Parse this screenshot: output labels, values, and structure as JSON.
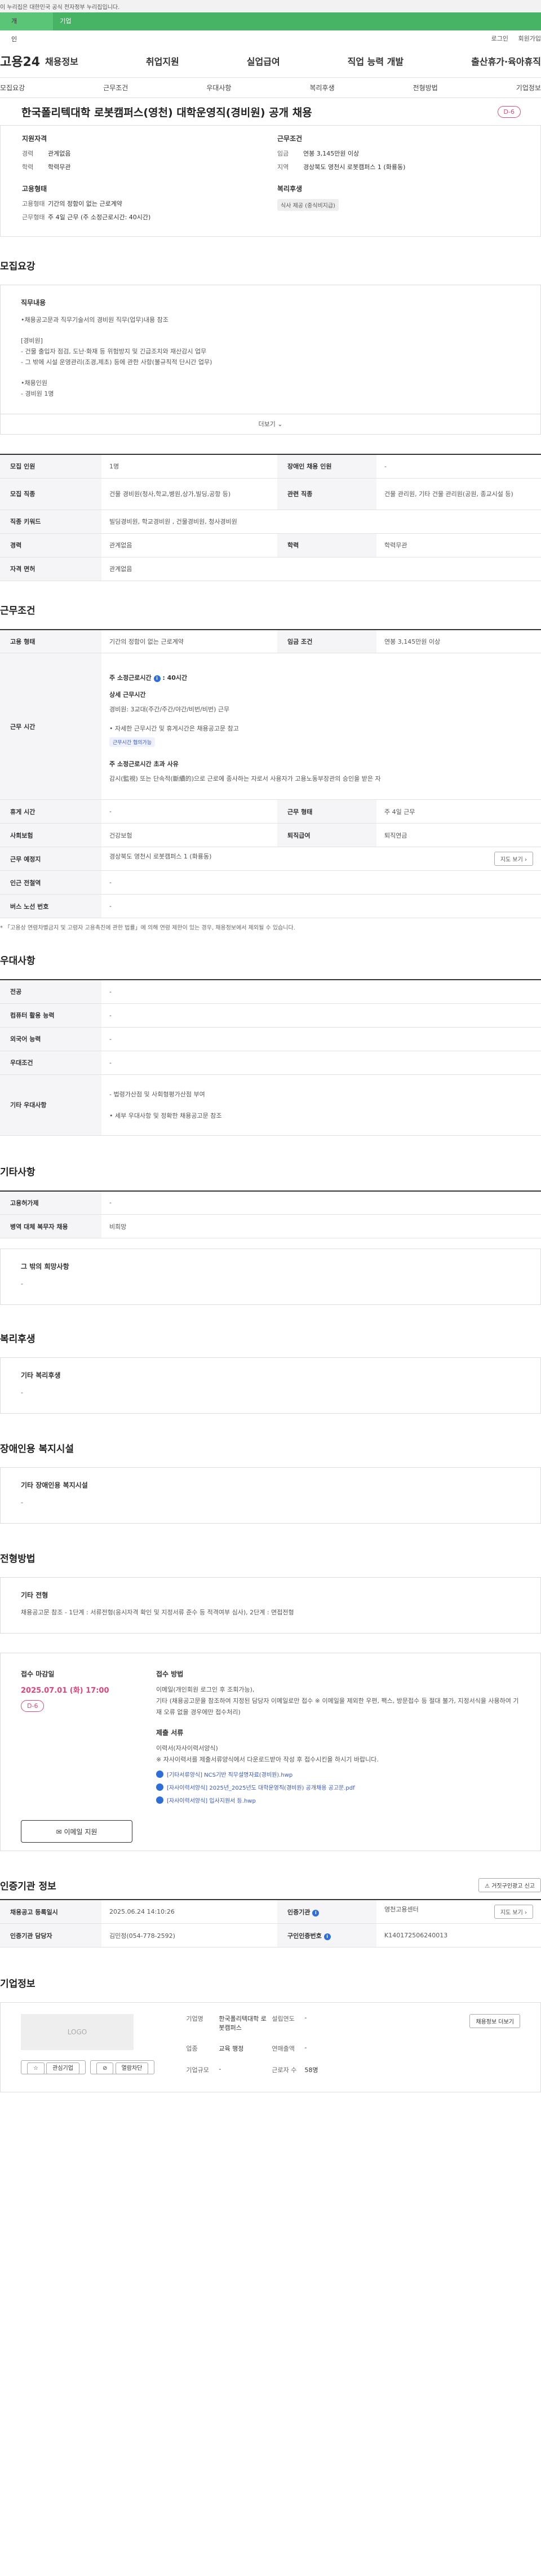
{
  "gov_notice": "이 누리집은 대한민국 공식 전자정부 누리집입니다.",
  "top_tabs": [
    "개인",
    "기업"
  ],
  "util_links": [
    "로그인",
    "회원가입"
  ],
  "logo": "고용24",
  "gnb_menu": [
    "채용정보",
    "취업지원",
    "실업급여",
    "직업 능력 개발",
    "출산휴가·육아휴직"
  ],
  "anchor_tabs": [
    "모집요강",
    "근무조건",
    "우대사항",
    "복리후생",
    "전형방법",
    "기업정보"
  ],
  "job": {
    "title": "한국폴리텍대학 로봇캠퍼스(영천) 대학운영직(경비원) 공개 채용",
    "dday": "D-6",
    "qual_title": "지원자격",
    "qual": [
      {
        "k": "경력",
        "v": "관계없음"
      },
      {
        "k": "학력",
        "v": "학력무관"
      }
    ],
    "cond_title": "근무조건",
    "cond": [
      {
        "k": "임금",
        "v": "연봉 3,145만원 이상"
      },
      {
        "k": "지역",
        "v": "경상북도 영천시 로봇캠퍼스 1 (화룡동)"
      }
    ],
    "emp_title": "고용형태",
    "emp": [
      {
        "k": "고용형태",
        "v": "기간의 정함이 없는 근로계약"
      },
      {
        "k": "근무형태",
        "v": "주 4일 근무 (주 소정근로시간: 40시간)"
      }
    ],
    "welfare_title": "복리후생",
    "welfare_tag": "식사 제공 (중식비지급)"
  },
  "recruit": {
    "section_title": "모집요강",
    "duty_title": "직무내용",
    "duty_lines": [
      "•채용공고문과 직무기술서의 경비원 직무(업무)내용 참조",
      "",
      "[경비원]",
      "- 건물 출입자 점검, 도난·화재 등 위험방지 및 긴급조치와 재산감시 업무",
      "- 그 밖에 시설 운영관리(조경,제초) 등에 관한 사항(불규칙적 단시간 업무)",
      "",
      "•채용인원",
      "- 경비원 1명"
    ],
    "more_label": "더보기",
    "rows": [
      {
        "k1": "모집 인원",
        "v1": "1명",
        "k2": "장애인 채용 인원",
        "v2": "-"
      },
      {
        "k1": "모집 직종",
        "v1": "건물 경비원(청사,학교,병원,상가,빌딩,공항 등)",
        "k2": "관련 직종",
        "v2": "건물 관리원, 기타 건물 관리원(공원, 종교시설 등)"
      }
    ],
    "keyword_label": "직종 키워드",
    "keyword_value": "빌딩경비원, 학교경비원 , 건물경비원, 청사경비원",
    "career_label": "경력",
    "career_value": "관계없음",
    "edu_label": "학력",
    "edu_value": "학력무관",
    "license_label": "자격 면허",
    "license_value": "관계없음"
  },
  "work": {
    "section_title": "근무조건",
    "emp_label": "고용 형태",
    "emp_value": "기간의 정함이 없는 근로계약",
    "wage_label": "임금 조건",
    "wage_value": "연봉 3,145만원 이상",
    "time_label": "근무 시간",
    "time_weekly": "주 소정근로시간",
    "time_weekly_val": "40시간",
    "time_detail_h": "상세 근무시간",
    "time_detail": "경비원: 3교대(주간/주간/야간/비번/비번) 근무",
    "time_more": "• 자세한 근무시간 및 휴게시간은 채용공고문 참고",
    "time_tag": "근무시간 협의가능",
    "time_special_h": "주 소정근로시간 초과 사유",
    "time_special": "감시(監視) 또는 단속적(斷續的)으로 근로에 종사하는 자로서 사용자가 고용노동부장관의 승인을 받은 자",
    "rest_label": "휴게 시간",
    "rest_value": "-",
    "form_label": "근무 형태",
    "form_value": "주 4일 근무",
    "ins_label": "사회보험",
    "ins_value": "건강보험",
    "retire_label": "퇴직급여",
    "retire_value": "퇴직연금",
    "place_label": "근무 예정지",
    "place_value": "경상북도 영천시 로봇캠퍼스 1 (화룡동)",
    "map_btn": "지도 보기",
    "subway_label": "인근 전철역",
    "subway_value": "-",
    "bus_label": "버스 노선 번호",
    "bus_value": "-",
    "note": "* 「고용상 연령차별금지 및 고령자 고용촉진에 관한 법률」에 의해 연령 제한이 있는 경우, 채용정보에서 제외될 수 있습니다."
  },
  "prefer": {
    "section_title": "우대사항",
    "rows": [
      {
        "k": "전공",
        "v": "-"
      },
      {
        "k": "컴퓨터 활용 능력",
        "v": "-"
      },
      {
        "k": "외국어 능력",
        "v": "-"
      },
      {
        "k": "우대조건",
        "v": "-"
      }
    ],
    "etc_label": "기타 우대사항",
    "etc_lines": [
      "- 법령가산점 및 사회형평가산점 부여",
      "• 세부 우대사항 및 정확한 채용공고문 참조"
    ]
  },
  "etc": {
    "section_title": "기타사항",
    "rows": [
      {
        "k": "고용허가제",
        "v": "-"
      },
      {
        "k": "병역 대체 복무자 채용",
        "v": "비희망"
      }
    ],
    "wish_title": "그 밖의 희망사항",
    "wish_value": "-"
  },
  "welfare": {
    "section_title": "복리후생",
    "box_title": "기타 복리후생",
    "box_value": "-"
  },
  "disabled": {
    "section_title": "장애인용 복지시설",
    "box_title": "기타 장애인용 복지시설",
    "box_value": "-"
  },
  "process": {
    "section_title": "전형방법",
    "box_title": "기타 전형",
    "box_value": "채용공고문 참조 - 1단계 : 서류전형(응시자격 확인 및 지정서류 준수 등 적격여부 심사), 2단계 : 면접전형"
  },
  "apply": {
    "deadline_title": "접수 마감일",
    "deadline": "2025.07.01 (화) 17:00",
    "dday": "D-6",
    "method_title": "접수 방법",
    "method_lines": [
      "이메일(개인회원 로그인 후 조회가능),",
      "기타 (채용공고문을 참조하여 지정된 담당자 이메일로만 접수 ※ 이메일을 제외한 우편, 팩스, 방문접수 등 절대 불가, 지정서식을 사용하여 기재 오류 없을 경우에만 접수처리)"
    ],
    "docs_title": "제출 서류",
    "docs_lines": [
      "이력서(자사이력서양식)",
      "※ 자사이력서를 제출서류양식에서 다운로드받아 작성 후 접수시킨을 하시기 바랍니다."
    ],
    "files": [
      "[기타서류양식] NCS기반 직무설명자료(경비원).hwp",
      "[자사이력서양식] 2025년_2025년도 대학운영직(경비원) 공개채용 공고문.pdf",
      "[자사이력서양식] 입사지원서 등.hwp"
    ],
    "mail_btn": "이메일 지원"
  },
  "cert": {
    "section_title": "인증기관 정보",
    "report_btn": "거짓구인광고 신고",
    "reg_date_label": "채용공고 등록일시",
    "reg_date": "2025.06.24 14:10:26",
    "agency_label": "인증기관",
    "agency": "영천고용센터",
    "map_btn": "지도 보기",
    "person_label": "인증기관 담당자",
    "person": "김민정(054-778-2592)",
    "num_label": "구인인증번호",
    "num": "K140172506240013"
  },
  "company": {
    "section_title": "기업정보",
    "logo_text": "LOGO",
    "interest_btn": "관심기업",
    "block_btn": "열람차단",
    "name_label": "기업명",
    "name": "한국폴리텍대학 로봇캠퍼스",
    "est_label": "설립연도",
    "est": "-",
    "biz_label": "업종",
    "biz": "교육 행정",
    "sales_label": "연매출액",
    "sales": "-",
    "size_label": "기업규모",
    "size": "-",
    "emp_label": "근로자 수",
    "emp": "58명",
    "detail_btn": "채용정보 더보기"
  }
}
